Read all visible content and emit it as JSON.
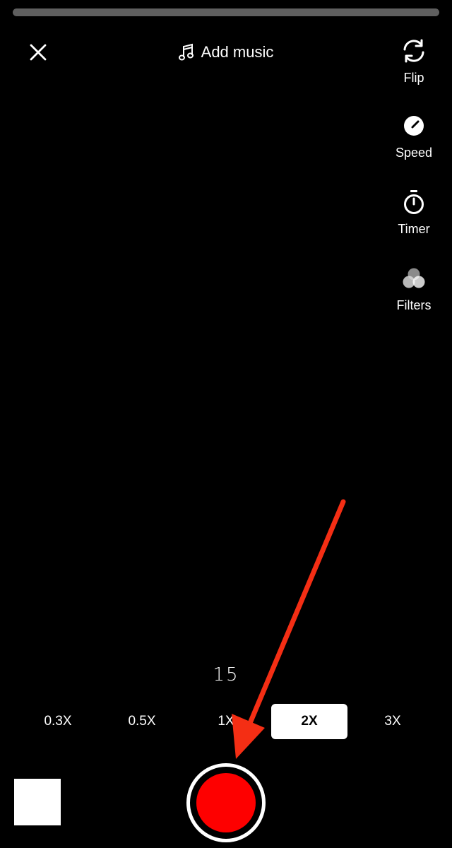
{
  "header": {
    "close_icon": "close-icon",
    "add_music_label": "Add music",
    "music_icon": "music-note-icon"
  },
  "side_tools": [
    {
      "label": "Flip",
      "icon": "flip-camera-icon"
    },
    {
      "label": "Speed",
      "icon": "speed-gauge-icon"
    },
    {
      "label": "Timer",
      "icon": "timer-icon"
    },
    {
      "label": "Filters",
      "icon": "filters-icon"
    }
  ],
  "recording": {
    "duration": "15",
    "speeds": [
      "0.3X",
      "0.5X",
      "1X",
      "2X",
      "3X"
    ],
    "selected_speed": "2X"
  },
  "colors": {
    "background": "#000000",
    "record_red": "#fe0000",
    "annotation_arrow": "#f42e14"
  }
}
